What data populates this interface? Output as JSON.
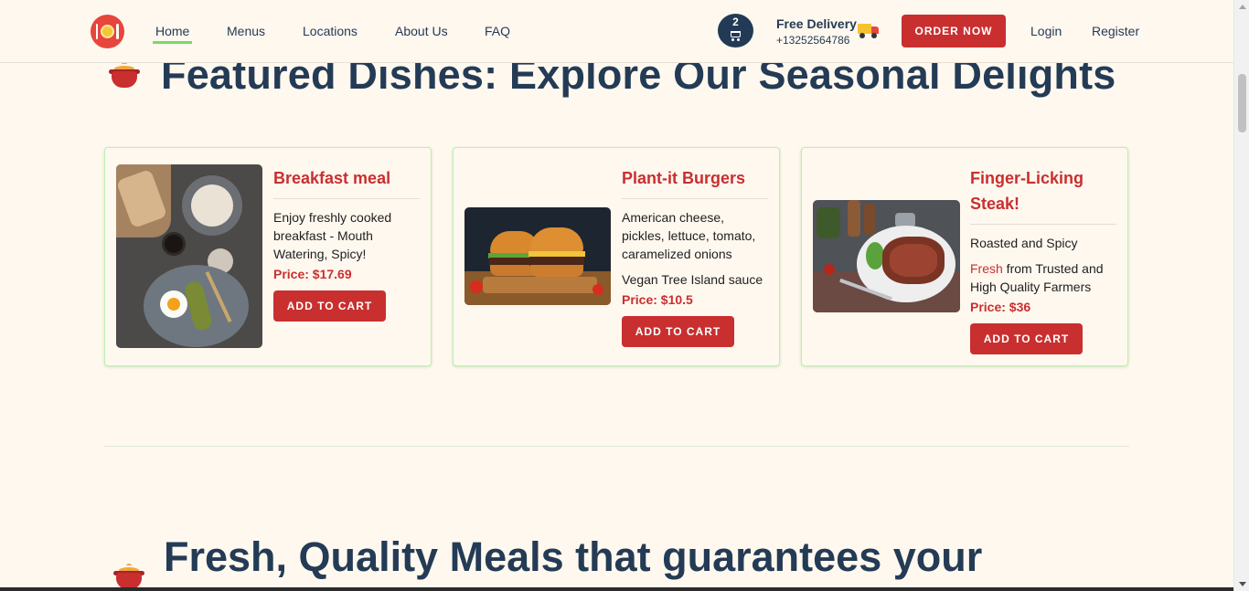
{
  "nav": {
    "items": [
      "Home",
      "Menus",
      "Locations",
      "About Us",
      "FAQ"
    ],
    "cart_count": "2",
    "delivery_title": "Free Delivery",
    "delivery_phone": "+13252564786",
    "order_label": "ORDER NOW",
    "login_label": "Login",
    "register_label": "Register"
  },
  "featured": {
    "title": "Featured Dishes: Explore Our Seasonal Delights",
    "cards": [
      {
        "title": "Breakfast meal",
        "texts": [
          "Enjoy freshly cooked breakfast - Mouth Watering, Spicy!"
        ],
        "price": "Price: $17.69",
        "button": "ADD TO CART"
      },
      {
        "title": "Plant-it Burgers",
        "texts": [
          "American cheese, pickles, lettuce, tomato, caramelized onions",
          "Vegan Tree Island sauce"
        ],
        "price": "Price: $10.5",
        "button": "ADD TO CART"
      },
      {
        "title": "Finger-Licking Steak!",
        "texts": [
          "Roasted and Spicy"
        ],
        "fresh_word": "Fresh",
        "fresh_rest": " from Trusted and High Quality Farmers",
        "price": "Price: $36",
        "button": "ADD TO CART"
      }
    ]
  },
  "second_section": {
    "title": "Fresh, Quality Meals that guarantees your"
  },
  "colors": {
    "accent": "#c92f2f",
    "heading": "#243b55",
    "background": "#fff8ef",
    "nav_active_underline": "#7dd86a"
  }
}
